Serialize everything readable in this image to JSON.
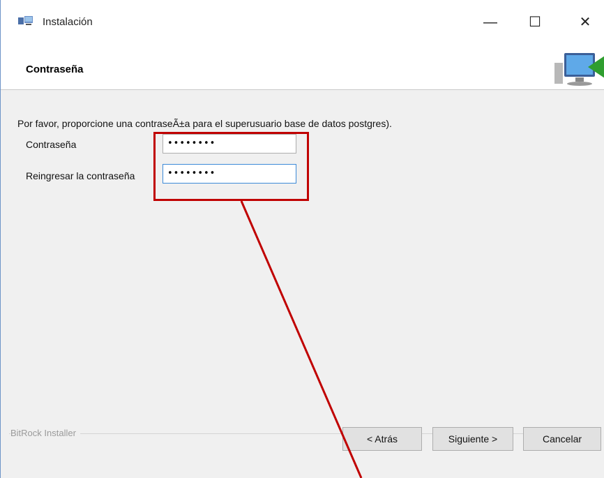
{
  "window": {
    "title": "Instalación",
    "controls": {
      "minimize": "—",
      "maximize": "☐",
      "close": "✕"
    }
  },
  "header": {
    "title": "Contraseña",
    "logo_icon": "installer-computer-icon"
  },
  "content": {
    "description": "Por favor, proporcione una contraseÃ±a para el superusuario base de datos postgres).",
    "password": {
      "label": "Contraseña",
      "value": "••••••••"
    },
    "confirm_password": {
      "label": "Reingresar la contraseña",
      "value": "••••••••"
    }
  },
  "footer": {
    "brand": "BitRock Installer",
    "back_label": "< Atrás",
    "next_label": "Siguiente >",
    "cancel_label": "Cancelar"
  },
  "annotation": {
    "color": "#c00000"
  }
}
